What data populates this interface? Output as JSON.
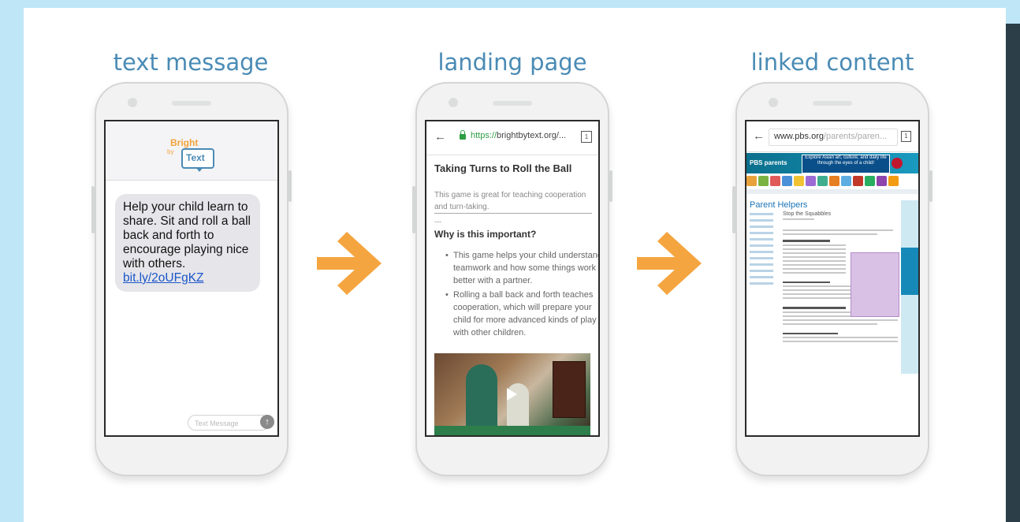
{
  "headings": {
    "text_message": "text message",
    "landing_page": "landing page",
    "linked_content": "linked content"
  },
  "colors": {
    "background": "#bfe6f6",
    "heading": "#4a8bb5",
    "arrow": "#f5a540",
    "link": "#1a55c9"
  },
  "sms": {
    "logo_bright": "Bright",
    "logo_to": "by",
    "logo_text": "Text",
    "message": "Help your child learn to share. Sit and roll a ball back and forth to encourage playing nice with others.",
    "link": "bit.ly/2oUFgKZ",
    "input_placeholder": "Text Message",
    "send_icon": "arrow-up-icon"
  },
  "landing": {
    "url_https": "https://",
    "url_host": "brightbytext.org/...",
    "tab_count": "1",
    "title": "Taking Turns to Roll the Ball",
    "intro": "This game is great for teaching cooperation and turn-taking.",
    "dash": "---",
    "subtitle": "Why is this important?",
    "bullets": [
      "This game helps your child understand teamwork and how some things work better with a partner.",
      "Rolling a ball back and forth teaches cooperation, which will prepare your child for more advanced kinds of play with other children."
    ]
  },
  "linked": {
    "url_host": "www.pbs.org",
    "url_path": "/parents/paren...",
    "tab_count": "1",
    "pbs_logo": "PBS parents",
    "banner_text": "Explore Asian art, culture, and daily life through the eyes of a child!",
    "page_title": "Parent Helpers",
    "article_title": "Stop the Squabbles"
  }
}
